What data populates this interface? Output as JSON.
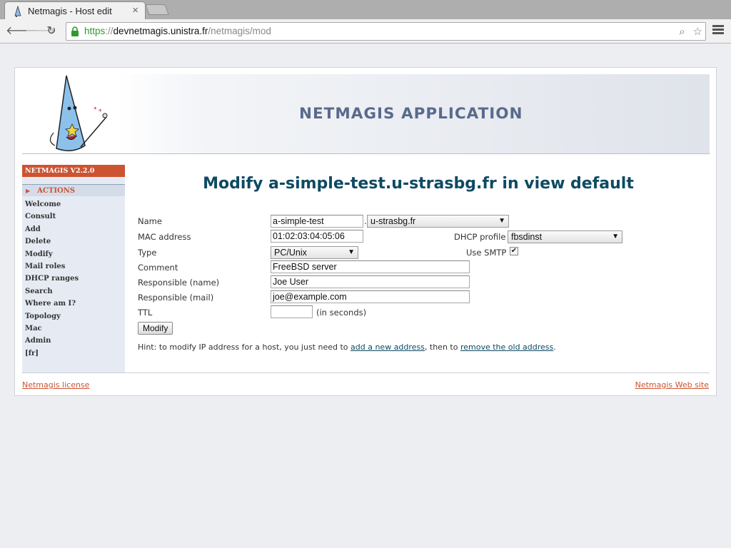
{
  "browser": {
    "tab_title": "Netmagis - Host edit",
    "tab_close": "×",
    "url_scheme": "https",
    "url_sep": "://",
    "url_host": "devnetmagis.unistra.fr",
    "url_path": "/netmagis/mod",
    "back_icon": "arrow-left",
    "forward_icon": "arrow-right",
    "reload_icon": "reload",
    "back_glyph": "🡐",
    "forward_glyph": "🡒",
    "reload_glyph": "↻",
    "search_glyph": "⌕",
    "star_glyph": "☆"
  },
  "header": {
    "app_title": "NETMAGIS APPLICATION"
  },
  "sidebar": {
    "version": "NETMAGIS V2.2.0",
    "section": "ACTIONS",
    "section_arrow": "▶",
    "items": [
      "Welcome",
      "Consult",
      "Add",
      "Delete",
      "Modify",
      "Mail roles",
      "DHCP ranges",
      "Search",
      "Where am I?",
      "Topology",
      "Mac",
      "Admin",
      "[fr]"
    ]
  },
  "main": {
    "title": "Modify a-simple-test.u-strasbg.fr in view default",
    "form": {
      "name_label": "Name",
      "name_value": "a-simple-test",
      "dot": ".",
      "domain_value": "u-strasbg.fr",
      "mac_label": "MAC address",
      "mac_value": "01:02:03:04:05:06",
      "dhcp_label": "DHCP profile",
      "dhcp_value": "fbsdinst",
      "type_label": "Type",
      "type_value": "PC/Unix",
      "smtp_label": "Use SMTP",
      "smtp_checked": "✔",
      "comment_label": "Comment",
      "comment_value": "FreeBSD server",
      "resp_name_label": "Responsible (name)",
      "resp_name_value": "Joe User",
      "resp_mail_label": "Responsible (mail)",
      "resp_mail_value": "joe@example.com",
      "ttl_label": "TTL",
      "ttl_value": "",
      "ttl_unit": "(in seconds)",
      "submit_label": "Modify"
    },
    "hint": {
      "prefix": "Hint: to modify IP address for a host, you just need to ",
      "link1": "add a new address",
      "middle": ", then to ",
      "link2": "remove the old address",
      "suffix": "."
    }
  },
  "footer": {
    "license_link": "Netmagis license",
    "website_link": "Netmagis Web site"
  },
  "colors": {
    "accent": "#cc5431",
    "title": "#0e4a63",
    "app_title": "#5a6a8e",
    "sidebar_bg": "#e6ebf3"
  },
  "glyphs": {
    "caret": "▼"
  }
}
